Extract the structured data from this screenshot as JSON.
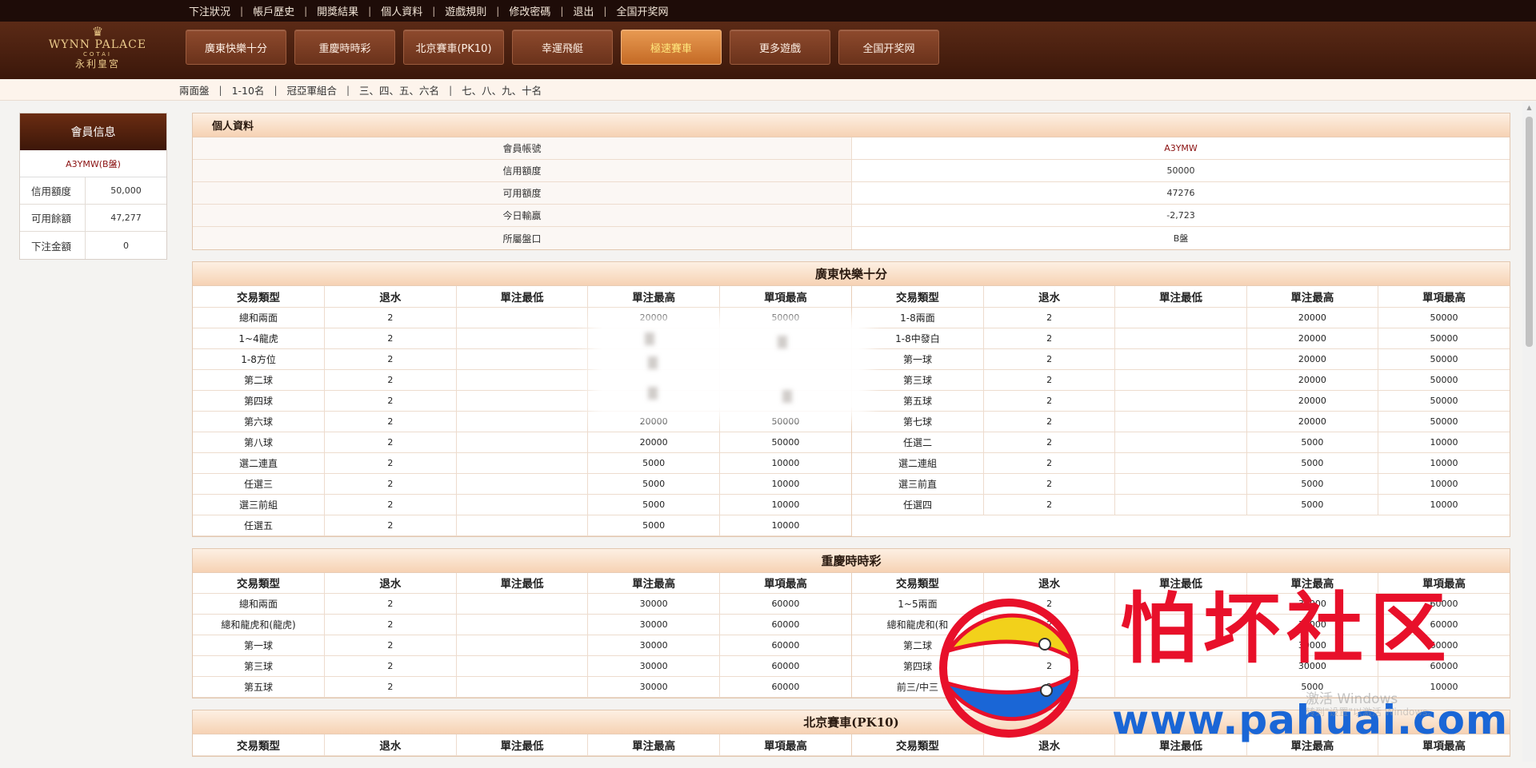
{
  "top_links": [
    "下注狀況",
    "帳戶歷史",
    "開獎結果",
    "個人資料",
    "遊戲規則",
    "修改密碼",
    "退出",
    "全国开奖网"
  ],
  "logo": {
    "brand": "WYNN PALACE",
    "sub": "COTAI",
    "cn": "永利皇宮"
  },
  "main_nav": [
    {
      "label": "廣東快樂十分",
      "active": false
    },
    {
      "label": "重慶時時彩",
      "active": false
    },
    {
      "label": "北京賽車(PK10)",
      "active": false
    },
    {
      "label": "幸運飛艇",
      "active": false
    },
    {
      "label": "極速賽車",
      "active": true
    },
    {
      "label": "更多遊戲",
      "active": false
    },
    {
      "label": "全国开奖网",
      "active": false
    }
  ],
  "sub_nav": [
    "兩面盤",
    "1-10名",
    "冠亞軍組合",
    "三、四、五、六名",
    "七、八、九、十名"
  ],
  "sidebar": {
    "title": "會員信息",
    "user": "A3YMW(B盤)",
    "rows": [
      {
        "label": "信用額度",
        "value": "50,000"
      },
      {
        "label": "可用餘額",
        "value": "47,277"
      },
      {
        "label": "下注金額",
        "value": "0"
      }
    ]
  },
  "profile": {
    "title": "個人資料",
    "rows": [
      {
        "label": "會員帳號",
        "value": "A3YMW"
      },
      {
        "label": "信用額度",
        "value": "50000"
      },
      {
        "label": "可用額度",
        "value": "47276"
      },
      {
        "label": "今日輸贏",
        "value": "-2,723"
      },
      {
        "label": "所屬盤口",
        "value": "B盤"
      }
    ]
  },
  "table_headers": [
    "交易類型",
    "退水",
    "單注最低",
    "單注最高",
    "單項最高"
  ],
  "games": [
    {
      "title": "廣東快樂十分",
      "left": [
        [
          "總和兩面",
          "2",
          "",
          "20000",
          "50000"
        ],
        [
          "1~4龍虎",
          "2",
          "",
          "",
          ""
        ],
        [
          "1-8方位",
          "2",
          "",
          "",
          ""
        ],
        [
          "第二球",
          "2",
          "",
          "",
          ""
        ],
        [
          "第四球",
          "2",
          "",
          "",
          ""
        ],
        [
          "第六球",
          "2",
          "",
          "20000",
          "50000"
        ],
        [
          "第八球",
          "2",
          "",
          "20000",
          "50000"
        ],
        [
          "選二連直",
          "2",
          "",
          "5000",
          "10000"
        ],
        [
          "任選三",
          "2",
          "",
          "5000",
          "10000"
        ],
        [
          "選三前組",
          "2",
          "",
          "5000",
          "10000"
        ],
        [
          "任選五",
          "2",
          "",
          "5000",
          "10000"
        ]
      ],
      "right": [
        [
          "1-8兩面",
          "2",
          "",
          "20000",
          "50000"
        ],
        [
          "1-8中發白",
          "2",
          "",
          "20000",
          "50000"
        ],
        [
          "第一球",
          "2",
          "",
          "20000",
          "50000"
        ],
        [
          "第三球",
          "2",
          "",
          "20000",
          "50000"
        ],
        [
          "第五球",
          "2",
          "",
          "20000",
          "50000"
        ],
        [
          "第七球",
          "2",
          "",
          "20000",
          "50000"
        ],
        [
          "任選二",
          "2",
          "",
          "5000",
          "10000"
        ],
        [
          "選二連組",
          "2",
          "",
          "5000",
          "10000"
        ],
        [
          "選三前直",
          "2",
          "",
          "5000",
          "10000"
        ],
        [
          "任選四",
          "2",
          "",
          "5000",
          "10000"
        ]
      ]
    },
    {
      "title": "重慶時時彩",
      "left": [
        [
          "總和兩面",
          "2",
          "",
          "30000",
          "60000"
        ],
        [
          "總和龍虎和(龍虎)",
          "2",
          "",
          "30000",
          "60000"
        ],
        [
          "第一球",
          "2",
          "",
          "30000",
          "60000"
        ],
        [
          "第三球",
          "2",
          "",
          "30000",
          "60000"
        ],
        [
          "第五球",
          "2",
          "",
          "30000",
          "60000"
        ]
      ],
      "right": [
        [
          "1~5兩面",
          "2",
          "",
          "30000",
          "60000"
        ],
        [
          "總和龍虎和(和",
          "2",
          "",
          "30000",
          "60000"
        ],
        [
          "第二球",
          "2",
          "",
          "30000",
          "60000"
        ],
        [
          "第四球",
          "2",
          "",
          "30000",
          "60000"
        ],
        [
          "前三/中三",
          "2",
          "",
          "5000",
          "10000"
        ]
      ]
    },
    {
      "title": "北京賽車(PK10)",
      "left": [],
      "right": []
    }
  ],
  "watermark": {
    "title": "怕坏社区",
    "url": "www.pahuai.com"
  },
  "windows_activation": {
    "line1": "激活 Windows",
    "line2": "转到\"设置\"以激活 Windows。"
  }
}
